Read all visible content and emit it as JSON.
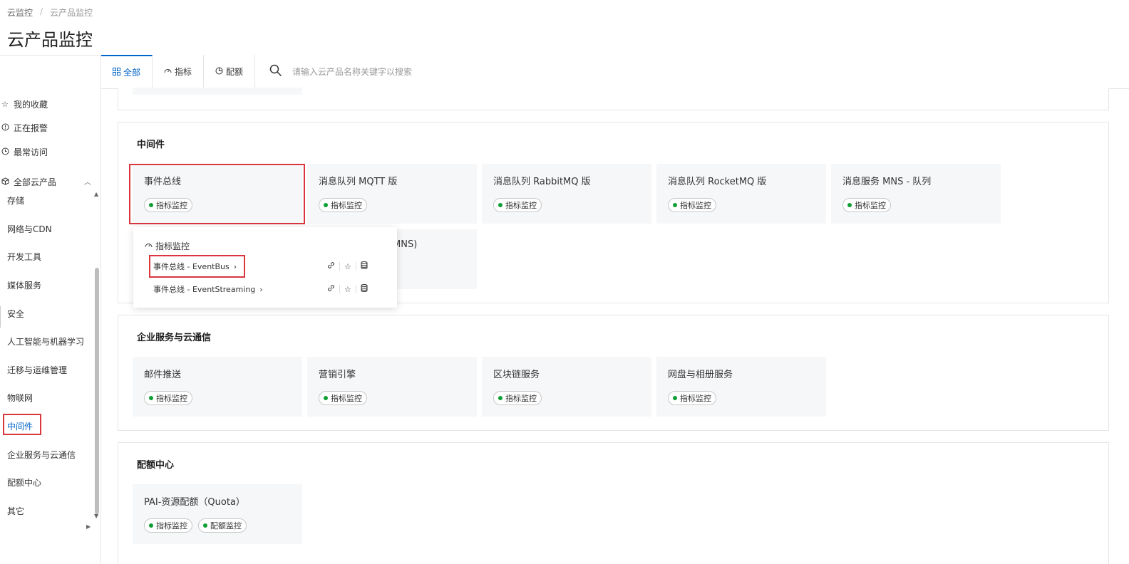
{
  "breadcrumb": [
    "云监控",
    "云产品监控"
  ],
  "title": "云产品监控",
  "tabs": [
    {
      "label": "全部",
      "icon": "grid-icon",
      "active": true
    },
    {
      "label": "指标",
      "icon": "gauge-icon",
      "active": false
    },
    {
      "label": "配额",
      "icon": "pie-icon",
      "active": false
    }
  ],
  "search": {
    "placeholder": "请输入云产品名称关键字以搜索"
  },
  "sidebar": {
    "top_items": [
      {
        "label": "我的收藏",
        "icon": "star-icon"
      },
      {
        "label": "正在报警",
        "icon": "alert-icon"
      },
      {
        "label": "最常访问",
        "icon": "clock-icon"
      }
    ],
    "all_products": {
      "label": "全部云产品",
      "icon": "cube-icon"
    },
    "categories": [
      {
        "label": "存储",
        "active": false
      },
      {
        "label": "网络与CDN",
        "active": false
      },
      {
        "label": "开发工具",
        "active": false
      },
      {
        "label": "媒体服务",
        "active": false
      },
      {
        "label": "安全",
        "active": false
      },
      {
        "label": "人工智能与机器学习",
        "active": false
      },
      {
        "label": "迁移与运维管理",
        "active": false
      },
      {
        "label": "物联网",
        "active": false
      },
      {
        "label": "中间件",
        "active": true
      },
      {
        "label": "企业服务与云通信",
        "active": false
      },
      {
        "label": "配额中心",
        "active": false
      },
      {
        "label": "其它",
        "active": false
      }
    ]
  },
  "sections": [
    {
      "title": "中间件",
      "cards": [
        {
          "name": "事件总线",
          "badges": [
            "指标监控"
          ]
        },
        {
          "name": "消息队列 MQTT 版",
          "badges": [
            "指标监控"
          ]
        },
        {
          "name": "消息队列 RabbitMQ 版",
          "badges": [
            "指标监控"
          ]
        },
        {
          "name": "消息队列 RocketMQ 版",
          "badges": [
            "指标监控"
          ]
        },
        {
          "name": "消息服务 MNS - 队列",
          "badges": [
            "指标监控"
          ]
        },
        {
          "name": "MNS)",
          "badges": []
        }
      ]
    },
    {
      "title": "企业服务与云通信",
      "cards": [
        {
          "name": "邮件推送",
          "badges": [
            "指标监控"
          ]
        },
        {
          "name": "营销引擎",
          "badges": [
            "指标监控"
          ]
        },
        {
          "name": "区块链服务",
          "badges": [
            "指标监控"
          ]
        },
        {
          "name": "网盘与相册服务",
          "badges": [
            "指标监控"
          ]
        }
      ]
    },
    {
      "title": "配额中心",
      "cards": [
        {
          "name": "PAI-资源配额（Quota）",
          "badges": [
            "指标监控",
            "配额监控"
          ]
        }
      ]
    }
  ],
  "popup": {
    "header": "指标监控",
    "items": [
      "事件总线 - EventBus",
      "事件总线 - EventStreaming"
    ]
  },
  "colors": {
    "accent": "#0064c8",
    "highlight": "#d9363e",
    "status_dot": "#0e9f34",
    "card_bg": "#f6f7f9"
  }
}
